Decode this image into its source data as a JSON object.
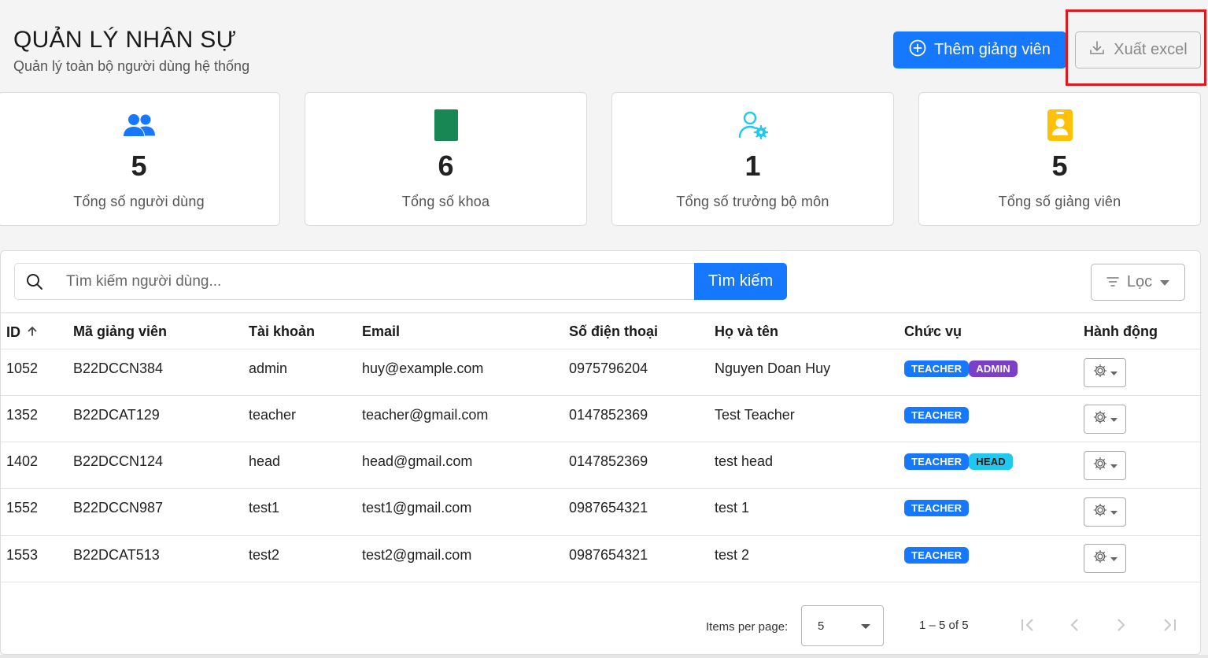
{
  "header": {
    "title": "QUẢN LÝ NHÂN SỰ",
    "subtitle": "Quản lý toàn bộ người dùng hệ thống",
    "add_button": "Thêm giảng viên",
    "export_button": "Xuất excel"
  },
  "stats": [
    {
      "value": "5",
      "label": "Tổng số người dùng",
      "icon": "users-icon",
      "color": "#1677ff"
    },
    {
      "value": "6",
      "label": "Tổng số khoa",
      "icon": "book-icon",
      "color": "#198754"
    },
    {
      "value": "1",
      "label": "Tổng số trưởng bộ môn",
      "icon": "user-gear-icon",
      "color": "#1ec8ef"
    },
    {
      "value": "5",
      "label": "Tổng số giảng viên",
      "icon": "badge-icon",
      "color": "#ffc107"
    }
  ],
  "search": {
    "placeholder": "Tìm kiếm người dùng...",
    "button": "Tìm kiếm",
    "filter_button": "Lọc"
  },
  "table": {
    "columns": [
      "ID",
      "Mã giảng viên",
      "Tài khoản",
      "Email",
      "Số điện thoại",
      "Họ và tên",
      "Chức vụ",
      "Hành động"
    ],
    "rows": [
      {
        "id": "1052",
        "code": "B22DCCN384",
        "account": "admin",
        "email": "huy@example.com",
        "phone": "0975796204",
        "name": "Nguyen Doan Huy",
        "roles": [
          "TEACHER",
          "ADMIN"
        ]
      },
      {
        "id": "1352",
        "code": "B22DCAT129",
        "account": "teacher",
        "email": "teacher@gmail.com",
        "phone": "0147852369",
        "name": "Test Teacher",
        "roles": [
          "TEACHER"
        ]
      },
      {
        "id": "1402",
        "code": "B22DCCN124",
        "account": "head",
        "email": "head@gmail.com",
        "phone": "0147852369",
        "name": "test head",
        "roles": [
          "TEACHER",
          "HEAD"
        ]
      },
      {
        "id": "1552",
        "code": "B22DCCN987",
        "account": "test1",
        "email": "test1@gmail.com",
        "phone": "0987654321",
        "name": "test 1",
        "roles": [
          "TEACHER"
        ]
      },
      {
        "id": "1553",
        "code": "B22DCAT513",
        "account": "test2",
        "email": "test2@gmail.com",
        "phone": "0987654321",
        "name": "test 2",
        "roles": [
          "TEACHER"
        ]
      }
    ]
  },
  "pagination": {
    "items_per_page_label": "Items per page:",
    "items_per_page_value": "5",
    "range": "1 – 5 of 5"
  }
}
